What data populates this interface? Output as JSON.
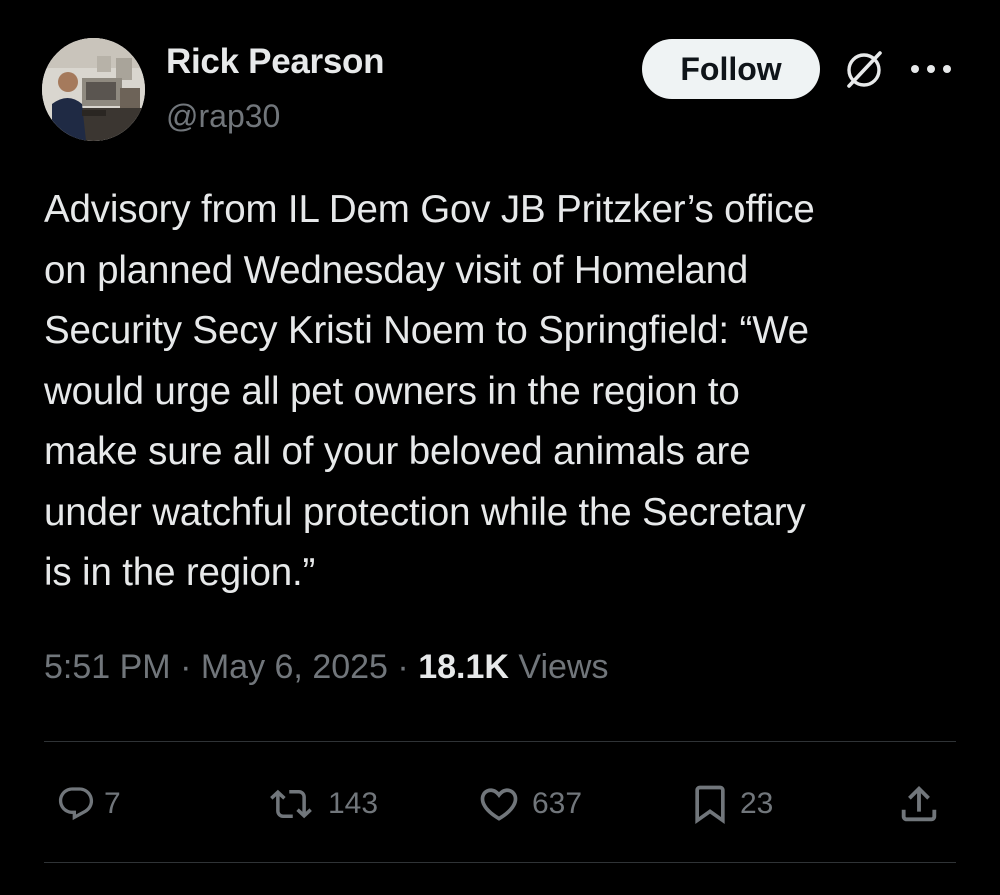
{
  "author": {
    "display_name": "Rick Pearson",
    "handle": "@rap30"
  },
  "header": {
    "follow_label": "Follow",
    "grok_icon": "grok-icon",
    "more_icon": "more-icon"
  },
  "tweet": {
    "text_lines": [
      "Advisory from IL Dem Gov JB Pritzker’s office",
      "on planned Wednesday visit of Homeland",
      "Security Secy Kristi Noem to Springfield: “We",
      "would urge all pet owners in the region to",
      "make sure all of your beloved animals are",
      "under watchful protection while the Secretary",
      "is in the region.”"
    ],
    "time": "5:51 PM",
    "date": "May 6, 2025",
    "separator": " · ",
    "views_count": "18.1K",
    "views_label": "Views"
  },
  "actions": {
    "replies": "7",
    "reposts": "143",
    "likes": "637",
    "bookmarks": "23"
  },
  "colors": {
    "background": "#000000",
    "text": "#e7e9ea",
    "muted": "#71767b",
    "divider": "#2f3336",
    "follow_bg": "#eff3f4"
  }
}
